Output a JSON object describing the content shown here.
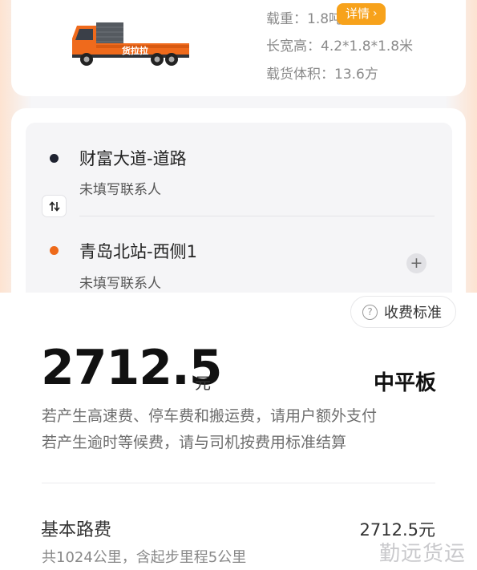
{
  "vehicle": {
    "load_label": "载重：1.8吨",
    "detail_button": "详情",
    "dimensions_label": "长宽高：4.2*1.8*1.8米",
    "volume_label": "载货体积：13.6方",
    "truck_brand_text": "货拉拉"
  },
  "route": {
    "start": {
      "address": "财富大道-道路",
      "contact": "未填写联系人"
    },
    "end": {
      "address": "青岛北站-西侧1",
      "contact": "未填写联系人"
    }
  },
  "fee": {
    "standard_button": "收费标准",
    "price": "2712.5",
    "unit": "元",
    "vehicle_type": "中平板",
    "note_1": "若产生高速费、停车费和搬运费，请用户额外支付",
    "note_2": "若产生逾时等候费，请与司机按费用标准结算",
    "base_label": "基本路费",
    "base_amount": "2712.5元",
    "base_detail": "共1024公里，含起步里程5公里"
  },
  "watermark": "勤远货运",
  "colors": {
    "accent_orange": "#f7a21b",
    "end_dot": "#ee6a1a",
    "start_dot": "#1e2230"
  }
}
